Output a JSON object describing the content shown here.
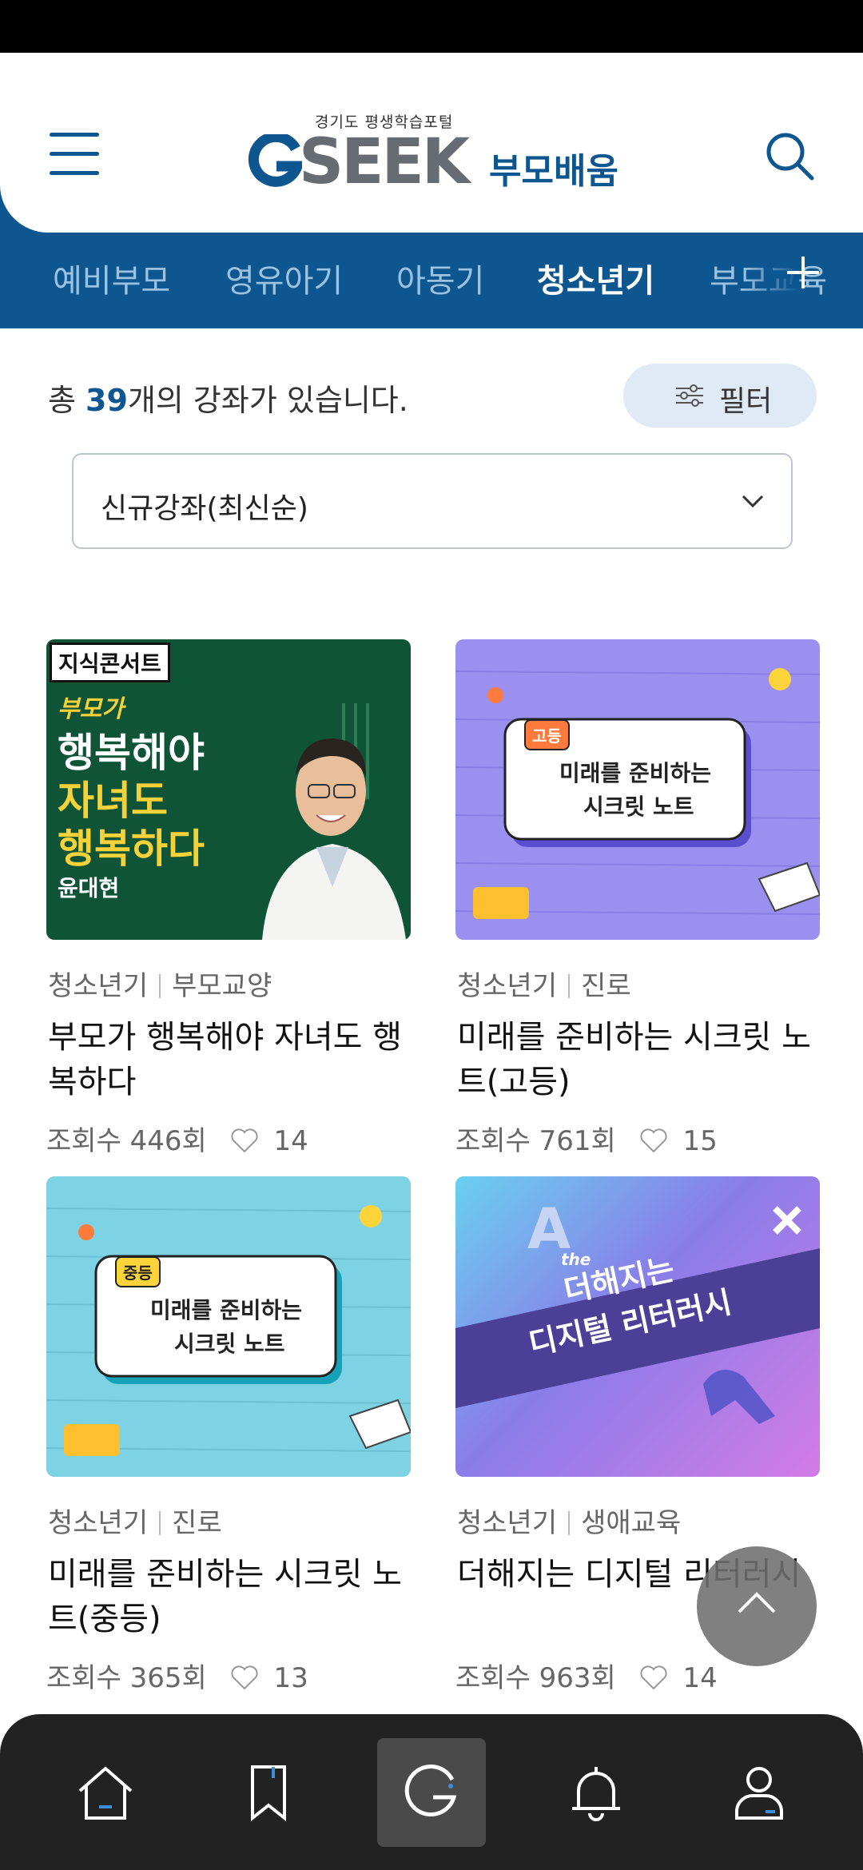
{
  "header": {
    "logo_sub": "경기도 평생학습포털",
    "logo_main": "SEEK",
    "logo_kor": "부모배움"
  },
  "tabs": [
    {
      "label": "예비부모",
      "active": false
    },
    {
      "label": "영유아기",
      "active": false
    },
    {
      "label": "아동기",
      "active": false
    },
    {
      "label": "청소년기",
      "active": true
    },
    {
      "label": "부모교육",
      "active": false
    }
  ],
  "summary": {
    "prefix": "총 ",
    "count": "39",
    "suffix": "개의 강좌가 있습니다."
  },
  "filter": {
    "label": "필터"
  },
  "sort": {
    "selected": "신규강좌(최신순)"
  },
  "courses": [
    {
      "category": "청소년기",
      "subcategory": "부모교양",
      "title": "부모가 행복해야 자녀도 행복하다",
      "views": "조회수 446회",
      "likes": "14",
      "thumb": {
        "tag": "지식콘서트",
        "line1": "부모가",
        "line2": "행복해야",
        "line3": "자녀도",
        "line4": "행복하다",
        "author": "윤대현"
      }
    },
    {
      "category": "청소년기",
      "subcategory": "진로",
      "title": "미래를 준비하는 시크릿 노트(고등)",
      "views": "조회수 761회",
      "likes": "15",
      "thumb": {
        "badge": "고등",
        "line1": "미래를 준비하는",
        "line2": "시크릿 노트"
      }
    },
    {
      "category": "청소년기",
      "subcategory": "진로",
      "title": "미래를 준비하는 시크릿 노트(중등)",
      "views": "조회수 365회",
      "likes": "13",
      "thumb": {
        "badge": "중등",
        "line1": "미래를 준비하는",
        "line2": "시크릿 노트"
      }
    },
    {
      "category": "청소년기",
      "subcategory": "생애교육",
      "title": "더해지는 디지털 리터러시",
      "views": "조회수 963회",
      "likes": "14",
      "thumb": {
        "small": "the",
        "line1": "더해지는",
        "line2": "디지털 리터러시"
      }
    }
  ],
  "colors": {
    "brand": "#0d5690",
    "green_thumb": "#0f5436",
    "purple_thumb": "#9b8ff0",
    "cyan_thumb": "#7dd2e3"
  },
  "icons": {
    "menu": "hamburger-icon",
    "search": "search-icon",
    "plus": "plus-icon",
    "filter": "sliders-icon",
    "chevron": "chevron-down-icon",
    "heart": "heart-icon",
    "scroll_top": "chevron-up-icon",
    "nav": [
      "home-icon",
      "bookmark-icon",
      "g-logo-icon",
      "bell-icon",
      "user-icon"
    ]
  }
}
